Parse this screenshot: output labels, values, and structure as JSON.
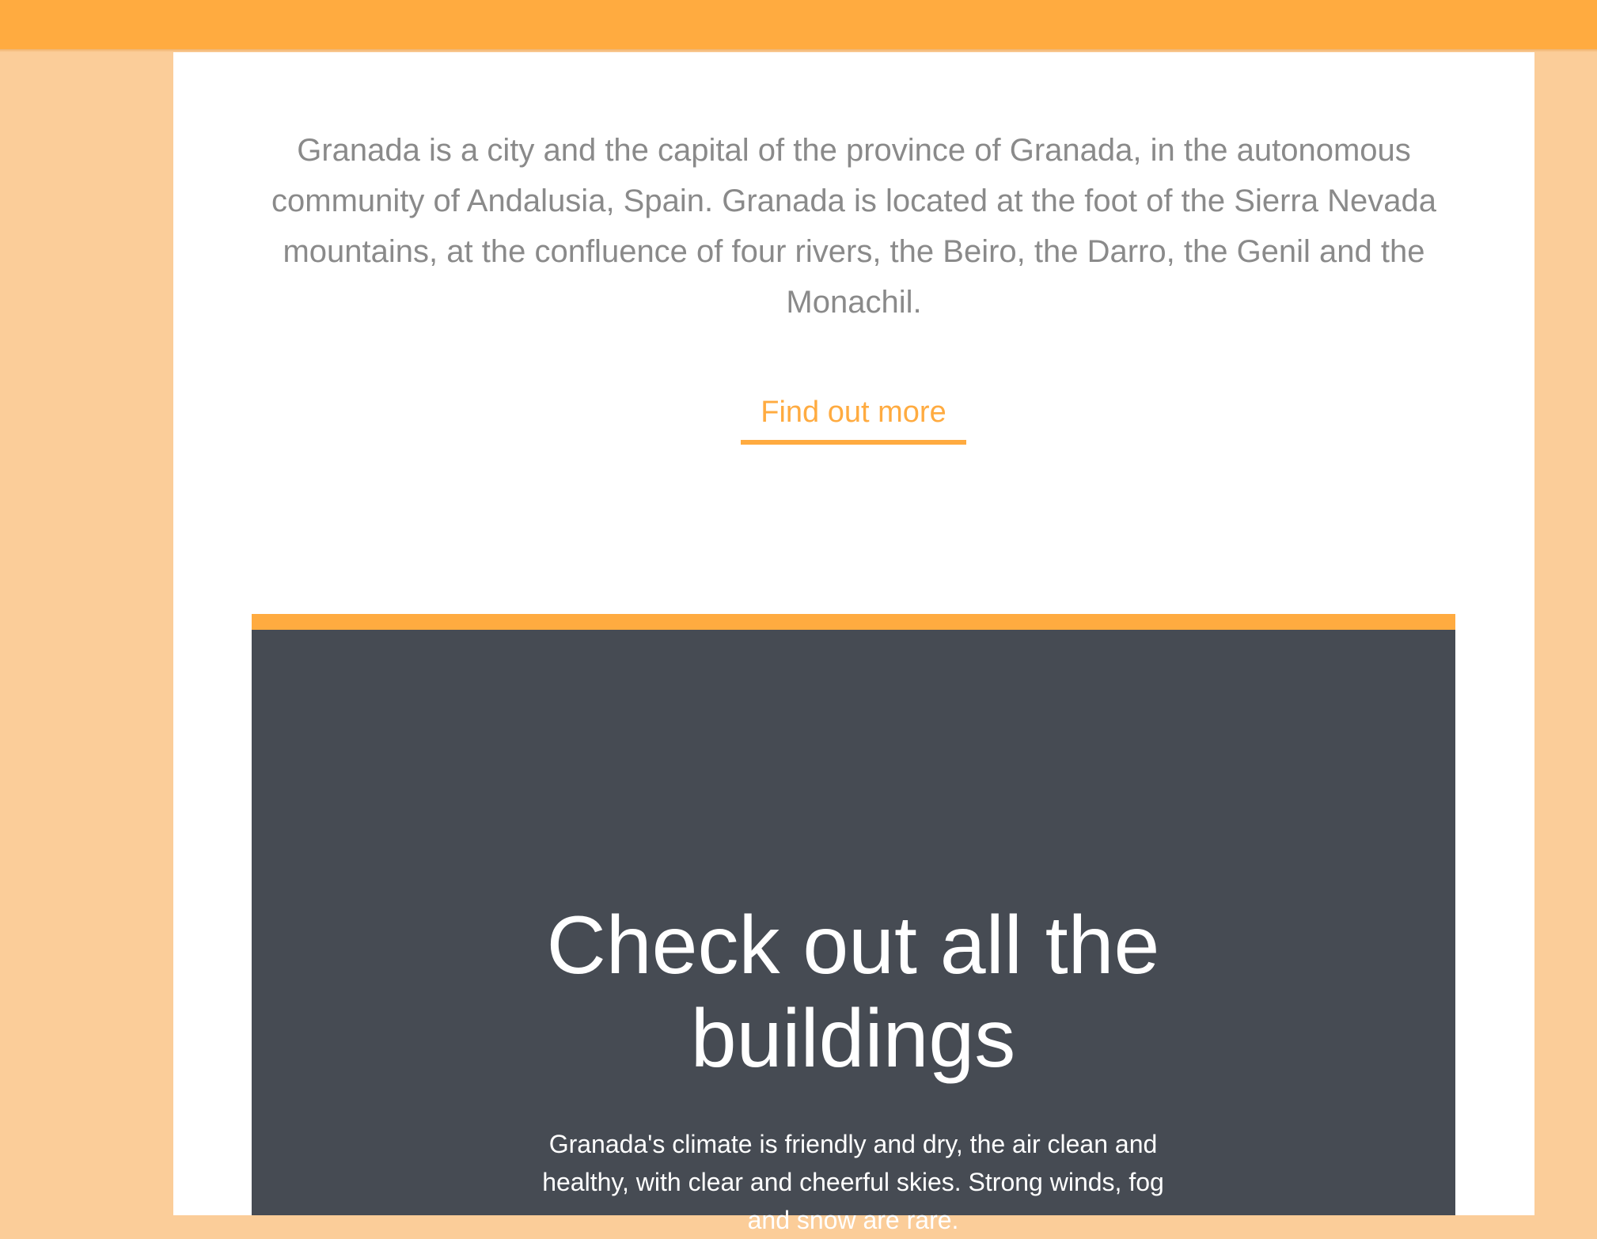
{
  "colors": {
    "accent": "#ffab40",
    "page_background": "#fbcd99",
    "card_background": "#464b53",
    "body_text": "#8a8a8a"
  },
  "intro": {
    "text": "Granada is a city and the capital of the province of Granada, in the autonomous community of Andalusia, Spain. Granada is located at the foot of the Sierra Nevada mountains, at the confluence of four rivers, the Beiro, the Darro, the Genil and the Monachil.",
    "link_label": "Find out more"
  },
  "promo": {
    "title": "Check out all the buildings",
    "text": "Granada's climate is friendly and dry, the air clean and healthy, with clear and cheerful skies. Strong winds, fog and snow are rare."
  }
}
